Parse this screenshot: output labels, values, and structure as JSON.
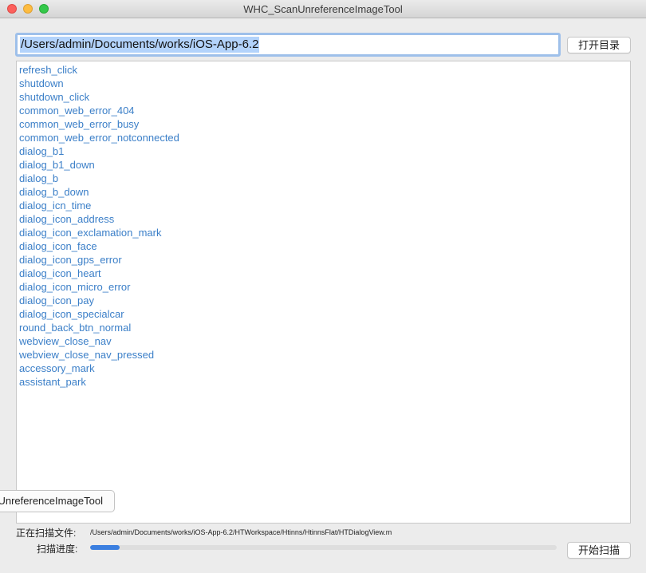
{
  "window": {
    "title": "WHC_ScanUnreferenceImageTool"
  },
  "path_field": {
    "value": "/Users/admin/Documents/works/iOS-App-6.2"
  },
  "buttons": {
    "open_dir": "打开目录",
    "start_scan": "开始扫描"
  },
  "image_list": [
    "refresh_click",
    "shutdown",
    "shutdown_click",
    "common_web_error_404",
    "common_web_error_busy",
    "common_web_error_notconnected",
    "dialog_b1",
    "dialog_b1_down",
    "dialog_b",
    "dialog_b_down",
    "dialog_icn_time",
    "dialog_icon_address",
    "dialog_icon_exclamation_mark",
    "dialog_icon_face",
    "dialog_icon_gps_error",
    "dialog_icon_heart",
    "dialog_icon_micro_error",
    "dialog_icon_pay",
    "dialog_icon_specialcar",
    "round_back_btn_normal",
    "webview_close_nav",
    "webview_close_nav_pressed",
    "accessory_mark",
    "assistant_park"
  ],
  "tooltip": {
    "text": "WHC_ScanUnreferenceImageTool"
  },
  "status": {
    "scanning_label": "正在扫描文件:",
    "scanning_file": "/Users/admin/Documents/works/iOS-App-6.2/HTWorkspace/Htinns/HtinnsFlat/HTDialogView.m",
    "progress_label": "扫描进度:",
    "progress": 0.064
  },
  "colors": {
    "list_text": "#3b7fc8",
    "progress_fill": "#3b7fe0",
    "selection": "#b3d3fb",
    "focus_ring": "#9ec0ea"
  }
}
